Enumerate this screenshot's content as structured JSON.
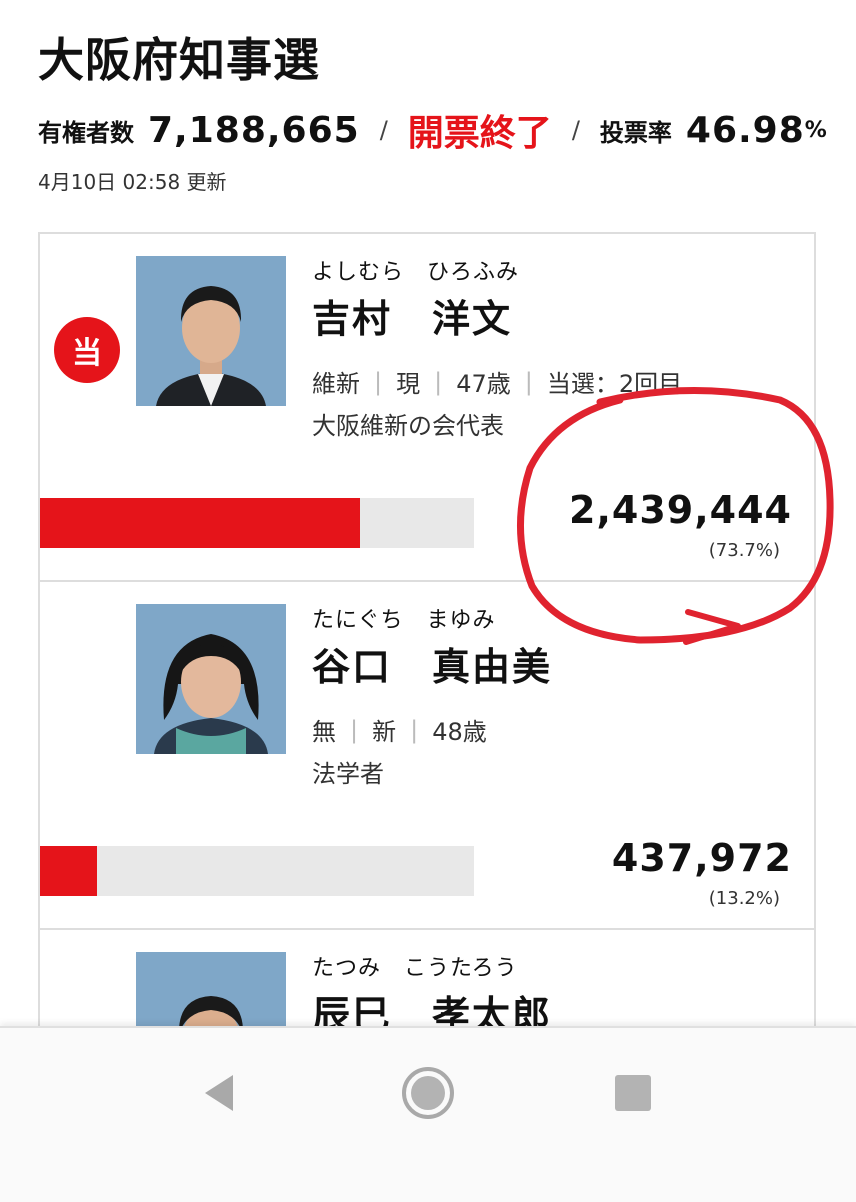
{
  "header": {
    "title": "大阪府知事選",
    "electorate_label": "有権者数",
    "electorate_value": "7,188,665",
    "separator": "/",
    "status": "開票終了",
    "turnout_label": "投票率",
    "turnout_value": "46.98",
    "turnout_unit": "%",
    "updated": "4月10日 02:58 更新"
  },
  "candidates": [
    {
      "kana": "よしむら　ひろふみ",
      "name": "吉村　洋文",
      "winner_badge": "当",
      "party": "維新",
      "status": "現",
      "age": "47歳",
      "elected": "当選：2回目",
      "description": "大阪維新の会代表",
      "votes": "2,439,444",
      "share_text": "(73.7%)",
      "share": 73.7
    },
    {
      "kana": "たにぐち　まゆみ",
      "name": "谷口　真由美",
      "party": "無",
      "status": "新",
      "age": "48歳",
      "description": "法学者",
      "votes": "437,972",
      "share_text": "(13.2%)",
      "share": 13.2
    },
    {
      "kana": "たつみ　こうたろう",
      "name": "辰巳　孝太郎"
    }
  ],
  "nav": {
    "back": "back-icon",
    "home": "home-icon",
    "recents": "recents-icon"
  },
  "colors": {
    "accent": "#e5141a",
    "bar_track": "#e8e8e8",
    "annotation": "#e0232f"
  }
}
